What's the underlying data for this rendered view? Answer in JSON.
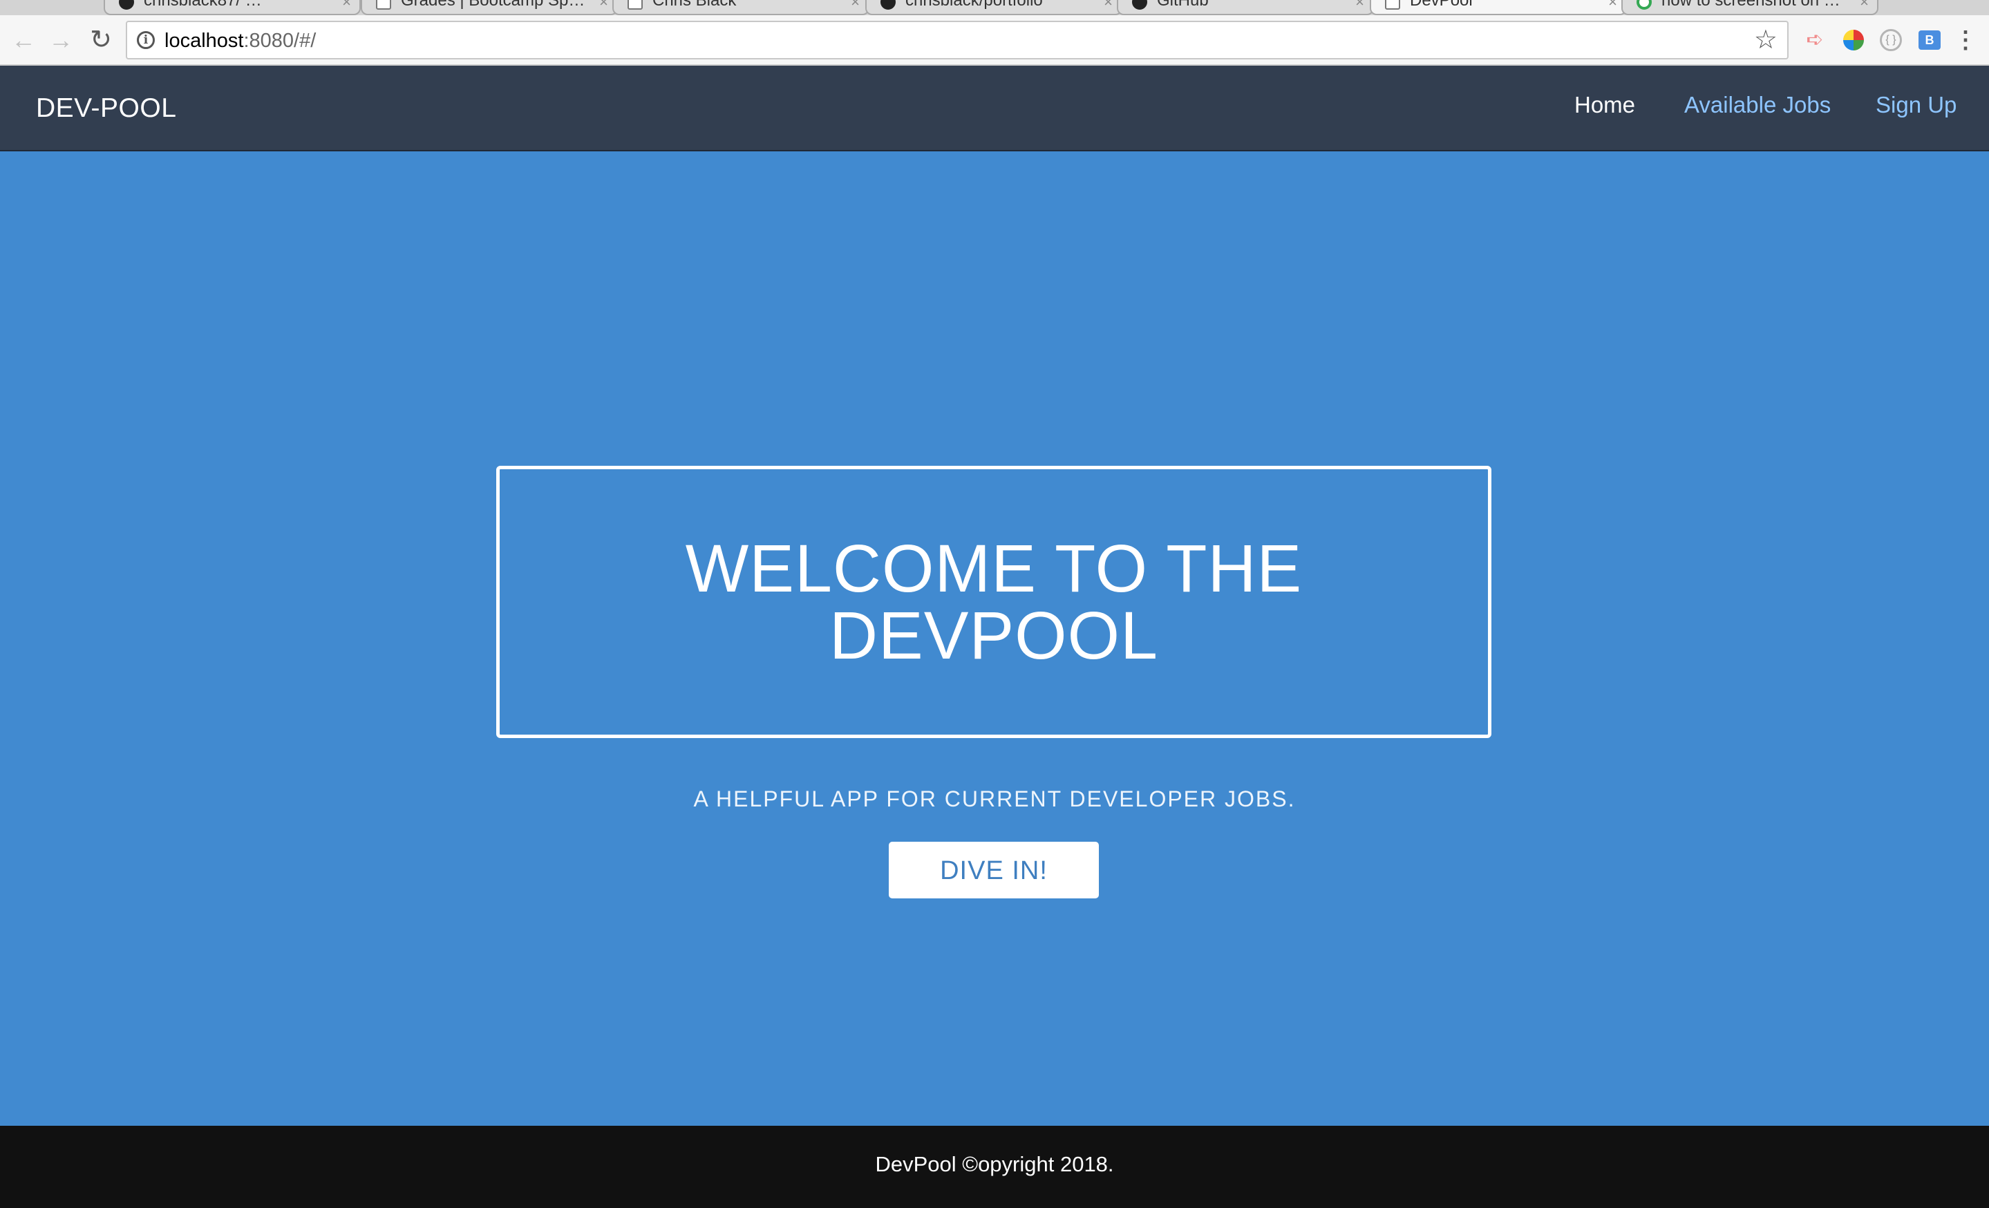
{
  "browser": {
    "tabs": [
      {
        "label": "chrisblack87/ …",
        "icon": "github-icon"
      },
      {
        "label": "Grades | Bootcamp Sp…",
        "icon": "page-icon"
      },
      {
        "label": "Chris Black",
        "icon": "page-icon"
      },
      {
        "label": "chrisblack/portfolio",
        "icon": "github-icon"
      },
      {
        "label": "GitHub",
        "icon": "github-icon"
      },
      {
        "label": "DevPool",
        "icon": "page-icon",
        "active": true
      },
      {
        "label": "how to screenshot on …",
        "icon": "google-icon"
      }
    ],
    "url_host": "localhost",
    "url_rest": ":8080/#/"
  },
  "navbar": {
    "brand": "DEV-POOL",
    "links": [
      "Home",
      "Available Jobs",
      "Sign Up"
    ]
  },
  "hero": {
    "title": "WELCOME TO THE DEVPOOL",
    "tagline": "A HELPFUL APP FOR CURRENT DEVELOPER JOBS.",
    "button": "DIVE IN!"
  },
  "footer": {
    "text": "DevPool ©opyright 2018."
  },
  "colors": {
    "navbar_bg": "#323e50",
    "hero_bg": "#418ad0",
    "link_color": "#8ec5ff",
    "footer_bg": "#111111"
  }
}
